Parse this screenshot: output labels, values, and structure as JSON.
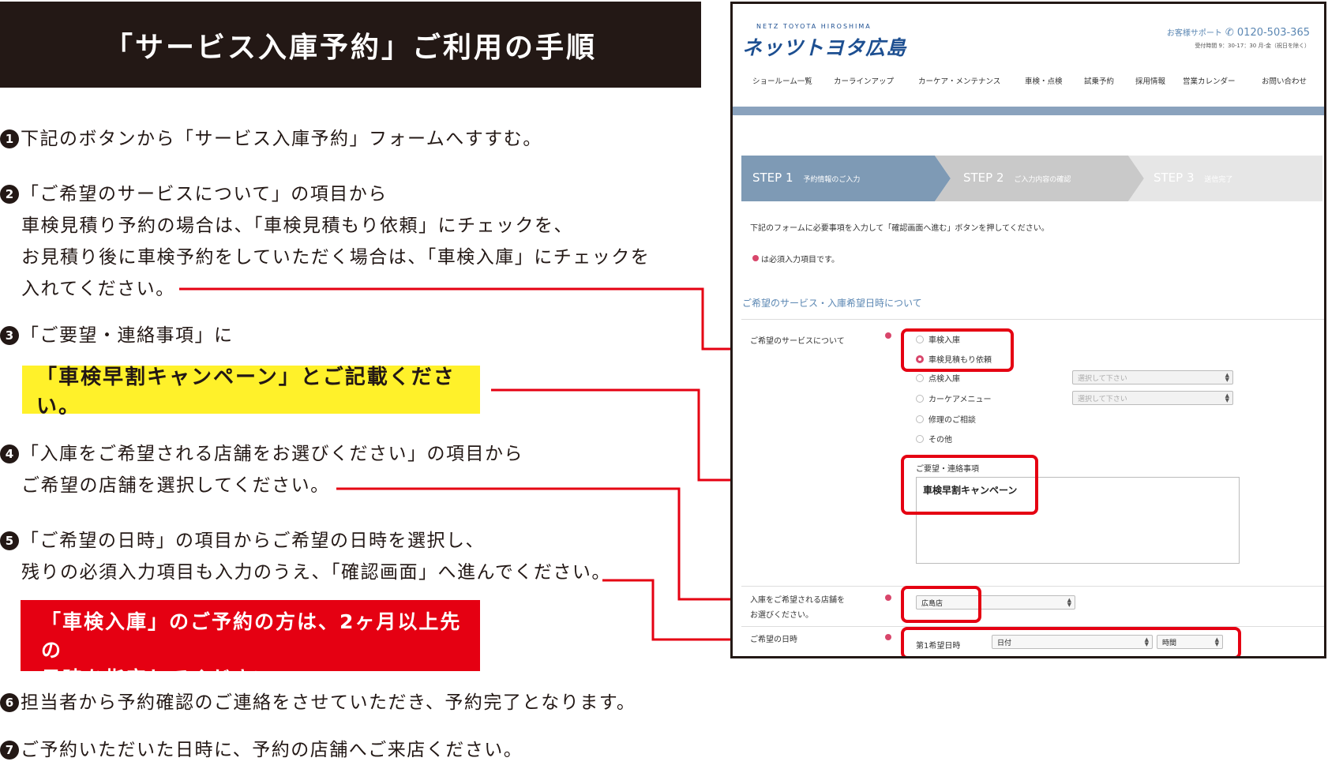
{
  "title": "「サービス入庫予約」ご利用の手順",
  "steps": [
    {
      "num": "1",
      "lines": [
        "下記のボタンから「サービス入庫予約」フォームへすすむ。"
      ]
    },
    {
      "num": "2",
      "lines": [
        "「ご希望のサービスについて」の項目から",
        "車検見積り予約の場合は、「車検見積もり依頼」にチェックを、",
        "お見積り後に車検予約をしていただく場合は、「車検入庫」にチェックを",
        "入れてください。"
      ]
    },
    {
      "num": "3",
      "lines": [
        "「ご要望・連絡事項」に"
      ]
    },
    {
      "num": "4",
      "lines": [
        "「入庫をご希望される店舗をお選びください」の項目から",
        "ご希望の店舗を選択してください。"
      ]
    },
    {
      "num": "5",
      "lines": [
        "「ご希望の日時」の項目からご希望の日時を選択し、",
        "残りの必須入力項目も入力のうえ、「確認画面」へ進んでください。"
      ]
    },
    {
      "num": "6",
      "lines": [
        "担当者から予約確認のご連絡をさせていただき、予約完了となります。"
      ]
    },
    {
      "num": "7",
      "lines": [
        "ご予約いただいた日時に、予約の店舗へご来店ください。"
      ]
    }
  ],
  "highlight_yellow": "「車検早割キャンペーン」とご記載ください。",
  "highlight_red": [
    "「車検入庫」のご予約の方は、2ヶ月以上先の",
    "日時を指定してください。"
  ],
  "site": {
    "brand_en": "NETZ TOYOTA HIROSHIMA",
    "brand_jp": "ネッツトヨタ広島",
    "support_label": "お客様サポート",
    "phone": "0120-503-365",
    "hours": "受付時間 9：30-17：30 月-金（祝日を除く）",
    "nav": [
      "ショールーム一覧",
      "カーラインアップ",
      "カーケア・メンテナンス",
      "車検・点検",
      "試乗予約",
      "採用情報",
      "営業カレンダー",
      "お問い合わせ"
    ]
  },
  "form": {
    "steps": [
      {
        "label": "STEP 1",
        "sub": "予約情報のご入力",
        "state": "active"
      },
      {
        "label": "STEP 2",
        "sub": "ご入力内容の確認",
        "state": "inactive"
      },
      {
        "label": "STEP 3",
        "sub": "送信完了",
        "state": "inactive"
      }
    ],
    "intro": "下記のフォームに必要事項を入力して「確認画面へ進む」ボタンを押してください。",
    "required_note": "は必須入力項目です。",
    "section_title": "ご希望のサービス・入庫希望日時について",
    "service_label": "ご希望のサービスについて",
    "service_options": [
      {
        "label": "車検入庫",
        "checked": false
      },
      {
        "label": "車検見積もり依頼",
        "checked": true
      },
      {
        "label": "点検入庫",
        "checked": false
      },
      {
        "label": "カーケアメニュー",
        "checked": false
      },
      {
        "label": "修理のご相談",
        "checked": false
      },
      {
        "label": "その他",
        "checked": false
      }
    ],
    "select_placeholder": "選択して下さい",
    "request_label": "ご要望・連絡事項",
    "request_value": "車検早割キャンペーン",
    "store_label_1": "入庫をご希望される店舗を",
    "store_label_2": "お選びください。",
    "store_value": "広島店",
    "date_label": "ご希望の日時",
    "date_sub": "第1希望日時",
    "date_value": "日付",
    "time_value": "時間"
  },
  "colors": {
    "red": "#e50012",
    "yellow": "#fff12a",
    "dark": "#231815",
    "step_active": "#7e9ab5",
    "step_inactive": "#c9c9c9",
    "required": "#d8466b"
  }
}
